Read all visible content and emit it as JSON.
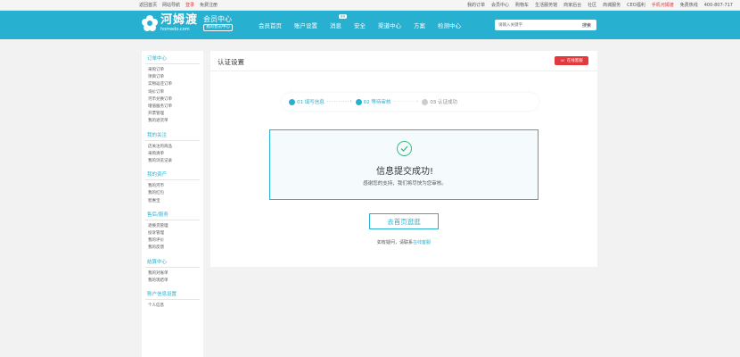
{
  "topbar": {
    "home_link": "返回首页",
    "nav_label": "网站导航",
    "login": "登录",
    "register": "免费注册",
    "right_links": [
      "我的订单",
      "会员中心",
      "购物车",
      "生活服务馆",
      "商家后台",
      "社区",
      "商城服务",
      "CEO福利",
      "手机河姆渡"
    ],
    "hotline_label": "免费热线",
    "hotline": "400-807-717"
  },
  "header": {
    "brand_cn": "河姆渡",
    "brand_en": "homedo.com",
    "member_title": "会员中心",
    "member_sub": "我的会员中心",
    "nav": [
      "会员首页",
      "账户设置",
      "消息",
      "安全",
      "渠道中心",
      "方案",
      "检测中心"
    ],
    "message_badge": "99",
    "search_placeholder": "请输入关键字",
    "search_button": "搜索"
  },
  "sidebar": {
    "groups": [
      {
        "title": "订单中心",
        "items": [
          "采购订单",
          "项目订单",
          "实物返还订单",
          "询价订单",
          "河币兑换订单",
          "增值服务订单",
          "开票管理",
          "我的退货单"
        ]
      },
      {
        "title": "我的关注",
        "items": [
          "店关注的商品",
          "采购清单",
          "我的浏览记录"
        ]
      },
      {
        "title": "我的资产",
        "items": [
          "我的河币",
          "我的红包",
          "智惠宝"
        ]
      },
      {
        "title": "售后/服务",
        "items": [
          "退换货管理",
          "投诉管理",
          "我的评价",
          "我的反馈"
        ]
      },
      {
        "title": "结算中心",
        "items": [
          "我的对账单",
          "我的现结单"
        ]
      },
      {
        "title": "账户信息设置",
        "items": [
          "个人信息"
        ]
      }
    ]
  },
  "main": {
    "title": "认证设置",
    "online_button": "在线客服",
    "steps": [
      {
        "label": "01 填写信息",
        "state": "done"
      },
      {
        "label": "02 等待审核",
        "state": "done"
      },
      {
        "label": "03 认证成功",
        "state": "todo"
      }
    ],
    "success_title": "信息提交成功!",
    "success_sub": "感谢您的支持，我们将尽快为您审核。",
    "go_button": "去首页逛逛",
    "contact_prefix": "如有疑问，请联系",
    "contact_link": "在线客服"
  },
  "colors": {
    "accent": "#27b0cf",
    "red": "#e4393c",
    "success": "#42b983"
  }
}
